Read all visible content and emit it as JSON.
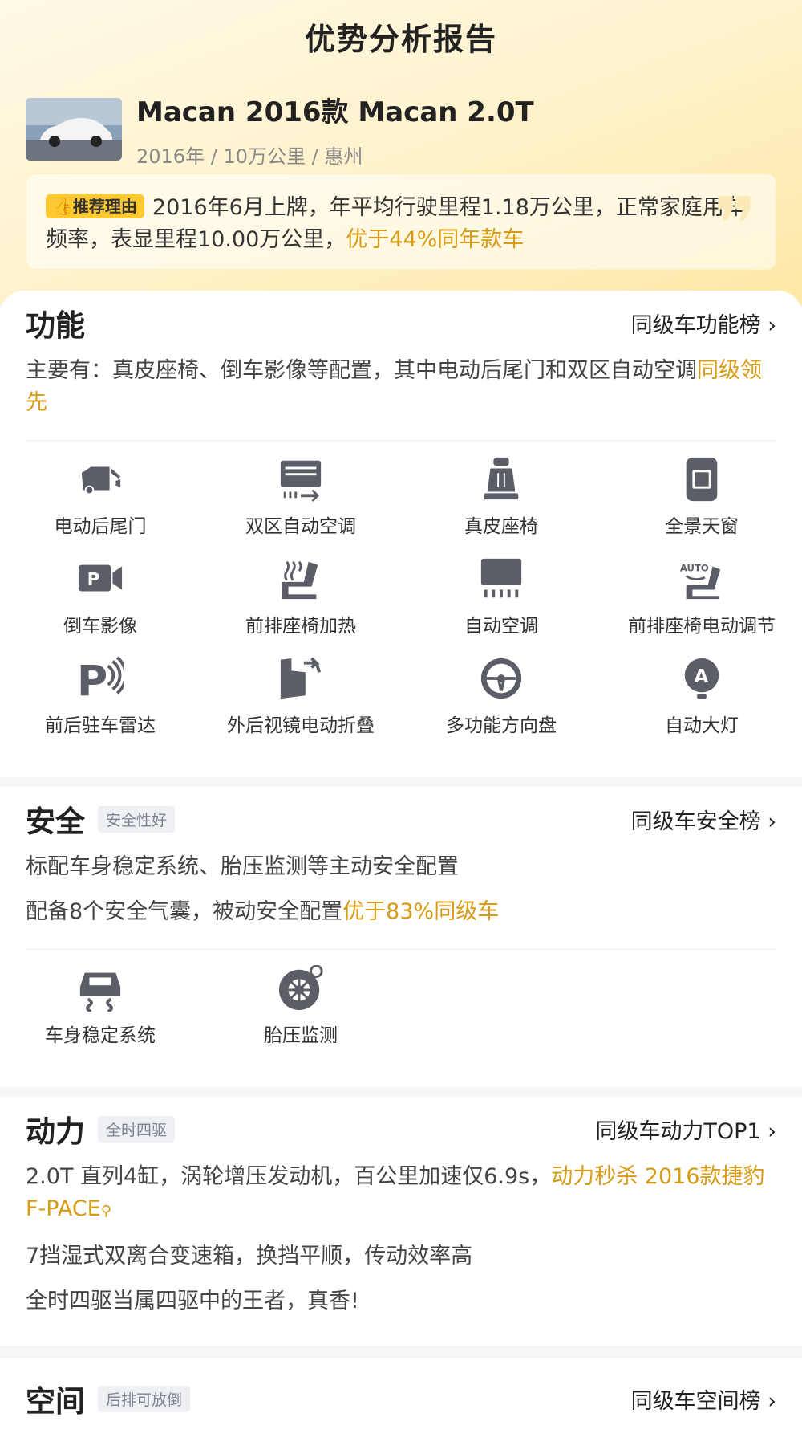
{
  "page_title": "优势分析报告",
  "car": {
    "name": "Macan 2016款 Macan 2.0T",
    "year": "2016年",
    "mileage": "10万公里",
    "city": "惠州",
    "sep": "/"
  },
  "reason": {
    "tag": "推荐理由",
    "text": "2016年6月上牌，年平均行驶里程1.18万公里，正常家庭用车频率，表显里程10.00万公里，",
    "highlight": "优于44%同年款车"
  },
  "function": {
    "title": "功能",
    "rank_link": "同级车功能榜 ›",
    "desc": "主要有：真皮座椅、倒车影像等配置，其中电动后尾门和双区自动空调",
    "desc_highlight": "同级领先",
    "features": [
      {
        "label": "电动后尾门",
        "icon": "power-tailgate-icon"
      },
      {
        "label": "双区自动空调",
        "icon": "dual-zone-ac-icon"
      },
      {
        "label": "真皮座椅",
        "icon": "leather-seat-icon"
      },
      {
        "label": "全景天窗",
        "icon": "panoramic-sunroof-icon"
      },
      {
        "label": "倒车影像",
        "icon": "reverse-camera-icon"
      },
      {
        "label": "前排座椅加热",
        "icon": "seat-heating-icon"
      },
      {
        "label": "自动空调",
        "icon": "auto-ac-icon"
      },
      {
        "label": "前排座椅电动调节",
        "icon": "power-seat-adjust-icon"
      },
      {
        "label": "前后驻车雷达",
        "icon": "parking-radar-icon"
      },
      {
        "label": "外后视镜电动折叠",
        "icon": "mirror-fold-icon"
      },
      {
        "label": "多功能方向盘",
        "icon": "steering-wheel-icon"
      },
      {
        "label": "自动大灯",
        "icon": "auto-headlight-icon"
      }
    ]
  },
  "safety": {
    "title": "安全",
    "badge": "安全性好",
    "rank_link": "同级车安全榜 ›",
    "line1": "标配车身稳定系统、胎压监测等主动安全配置",
    "line2": "配备8个安全气囊，被动安全配置",
    "line2_highlight": "优于83%同级车",
    "features": [
      {
        "label": "车身稳定系统",
        "icon": "stability-control-icon"
      },
      {
        "label": "胎压监测",
        "icon": "tire-pressure-icon"
      }
    ]
  },
  "power": {
    "title": "动力",
    "badge": "全时四驱",
    "rank_link": "同级车动力TOP1 ›",
    "line1": "2.0T 直列4缸，涡轮增压发动机，百公里加速仅6.9s，",
    "line1_highlight": "动力秒杀 2016款捷豹F-PACE",
    "line2": "7挡湿式双离合变速箱，换挡平顺，传动效率高",
    "line3": "全时四驱当属四驱中的王者，真香!"
  },
  "space": {
    "title": "空间",
    "badge": "后排可放倒",
    "rank_link": "同级车空间榜 ›"
  },
  "colors": {
    "accent": "#d89b14",
    "tag_bg": "#ffc934",
    "icon": "#5b5e66"
  }
}
